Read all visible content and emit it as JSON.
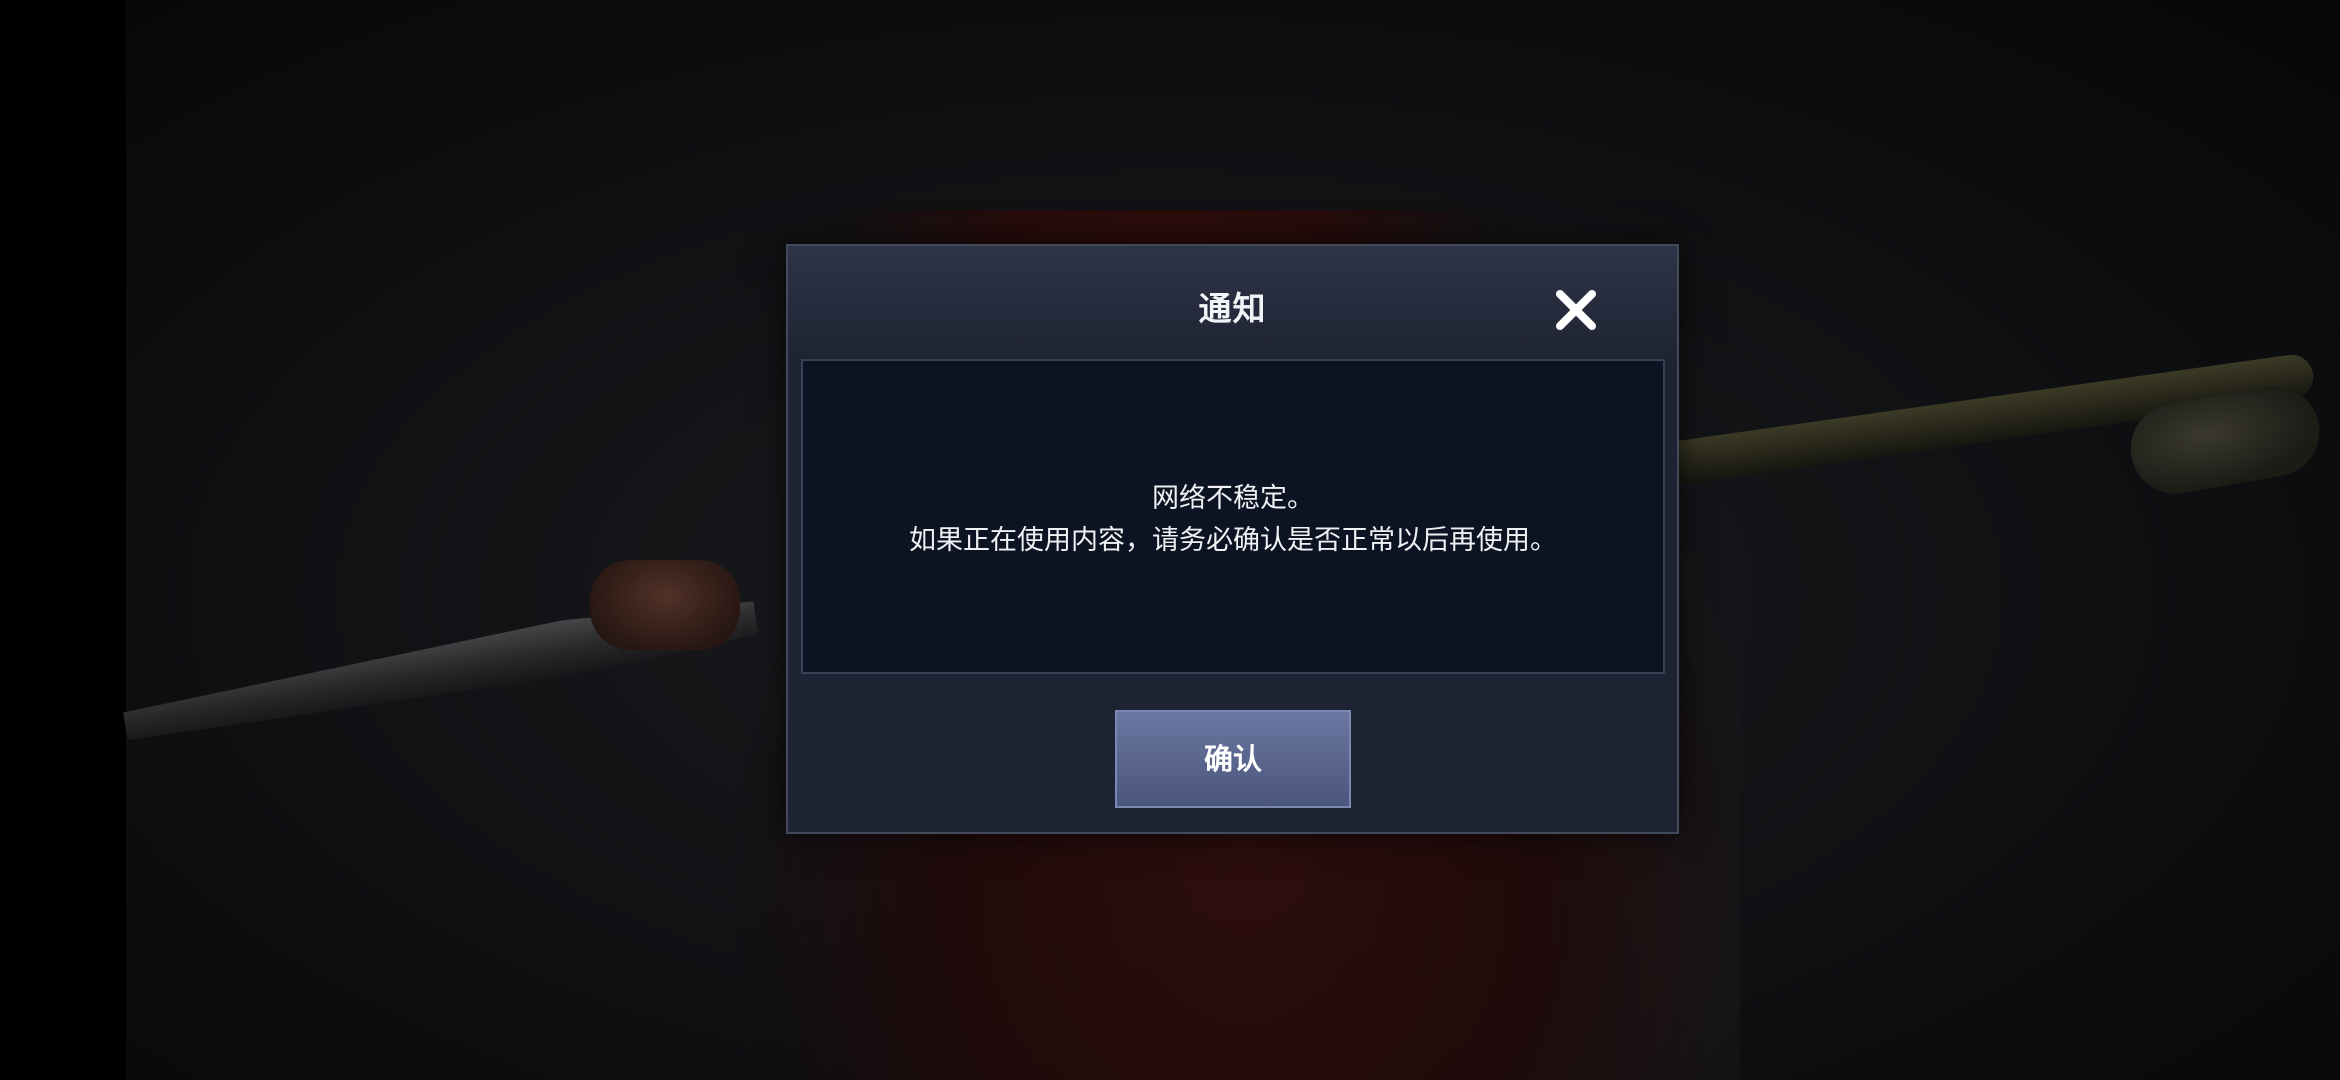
{
  "dialog": {
    "title": "通知",
    "message_line1": "网络不稳定。",
    "message_line2": "如果正在使用内容，请务必确认是否正常以后再使用。",
    "confirm_label": "确认",
    "close_icon": "close-icon"
  },
  "colors": {
    "dialog_bg": "#1e2333",
    "body_bg": "#0c1322",
    "button_bg": "#5a668f",
    "text": "#f0f1f4"
  }
}
